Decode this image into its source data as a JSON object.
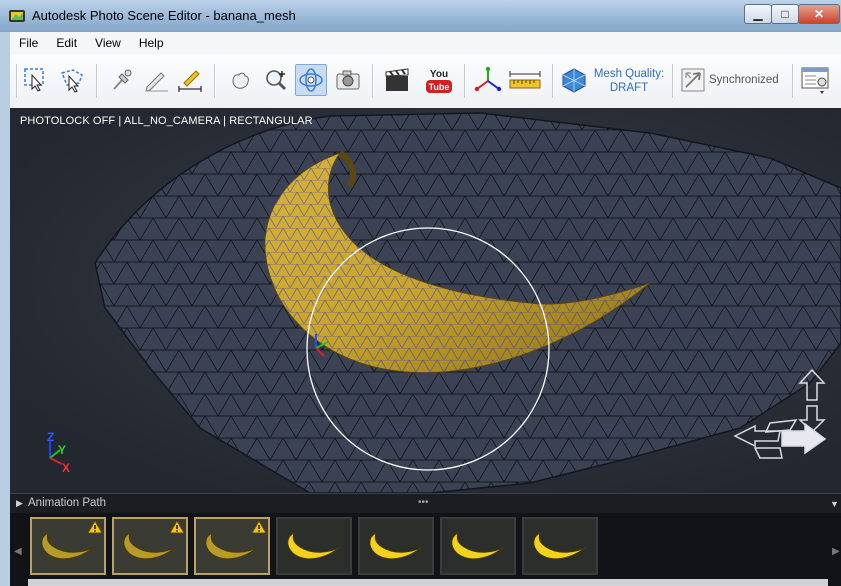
{
  "window": {
    "title": "Autodesk Photo Scene Editor - banana_mesh",
    "minimize_label": "▁",
    "maximize_label": "□",
    "close_label": "✕"
  },
  "menu": [
    {
      "label": "File"
    },
    {
      "label": "Edit"
    },
    {
      "label": "View"
    },
    {
      "label": "Help"
    }
  ],
  "toolbar": {
    "tools": [
      {
        "name": "rect-select-icon"
      },
      {
        "name": "lasso-select-icon"
      },
      {
        "name": "reference-point-icon"
      },
      {
        "name": "pencil-icon"
      },
      {
        "name": "measure-pencil-icon"
      },
      {
        "name": "pan-hand-icon"
      },
      {
        "name": "zoom-icon"
      },
      {
        "name": "orbit-icon",
        "active": true
      },
      {
        "name": "camera-icon"
      },
      {
        "name": "clapperboard-icon"
      },
      {
        "name": "youtube-icon",
        "text_top": "You",
        "text_bottom": "Tube"
      },
      {
        "name": "axis-icon"
      },
      {
        "name": "ruler-icon"
      },
      {
        "name": "mesh-quality-icon"
      },
      {
        "name": "sync-icon"
      },
      {
        "name": "settings-panel-icon"
      }
    ],
    "mesh_quality_label": "Mesh Quality:",
    "mesh_quality_value": "DRAFT",
    "sync_label": "Synchronized"
  },
  "viewport": {
    "status": "PHOTOLOCK OFF | ALL_NO_CAMERA | RECTANGULAR",
    "axis_labels": {
      "x": "X",
      "y": "Y",
      "z": "Z"
    }
  },
  "animation_path": {
    "title": "Animation Path",
    "dots": "•••",
    "thumbnails": [
      {
        "warning": true,
        "selected": true
      },
      {
        "warning": true,
        "selected": true
      },
      {
        "warning": true,
        "selected": true
      },
      {
        "warning": false,
        "selected": false
      },
      {
        "warning": false,
        "selected": false
      },
      {
        "warning": false,
        "selected": false
      },
      {
        "warning": false,
        "selected": false
      }
    ]
  },
  "colors": {
    "accent_blue": "#2c6cc2",
    "selected_thumb_border": "#b8a165",
    "banana_yellow": "#e8c21a"
  }
}
